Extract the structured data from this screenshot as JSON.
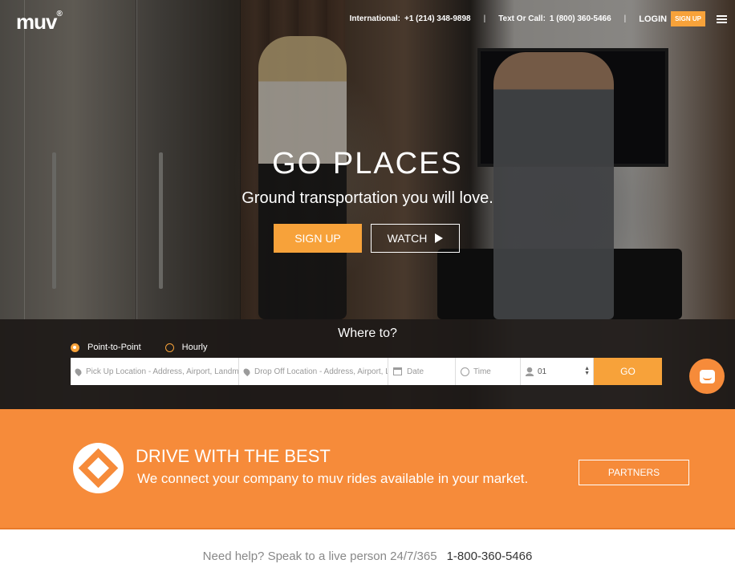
{
  "brand": {
    "logo": "muv",
    "registered": "®"
  },
  "topbar": {
    "international_label": "International:",
    "international_phone": "+1 (214) 348-9898",
    "text_label": "Text Or Call:",
    "text_phone": "1 (800) 360-5466",
    "login": "LOGIN",
    "signup": "SIGN UP"
  },
  "hero": {
    "headline": "GO PLACES",
    "subline": "Ground transportation you will love.",
    "signup_button": "SIGN UP",
    "watch_button": "WATCH"
  },
  "booking": {
    "title": "Where to?",
    "modes": [
      "Point-to-Point",
      "Hourly"
    ],
    "selected_mode": "Point-to-Point",
    "pickup_placeholder": "Pick Up Location - Address, Airport, Landmark",
    "dropoff_placeholder": "Drop Off Location - Address, Airport, Landmark",
    "date_placeholder": "Date",
    "time_placeholder": "Time",
    "passengers": "01",
    "go": "GO"
  },
  "promo": {
    "title": "DRIVE WITH THE BEST",
    "subtitle": "We connect your company to muv rides available in your market.",
    "partners_button": "PARTNERS"
  },
  "help": {
    "text": "Need help? Speak to a live person 24/7/365",
    "phone": "1-800-360-5466"
  },
  "colors": {
    "accent": "#f7a23a",
    "orange_band": "#f68b3a",
    "booking_bg": "#1e1a18"
  }
}
